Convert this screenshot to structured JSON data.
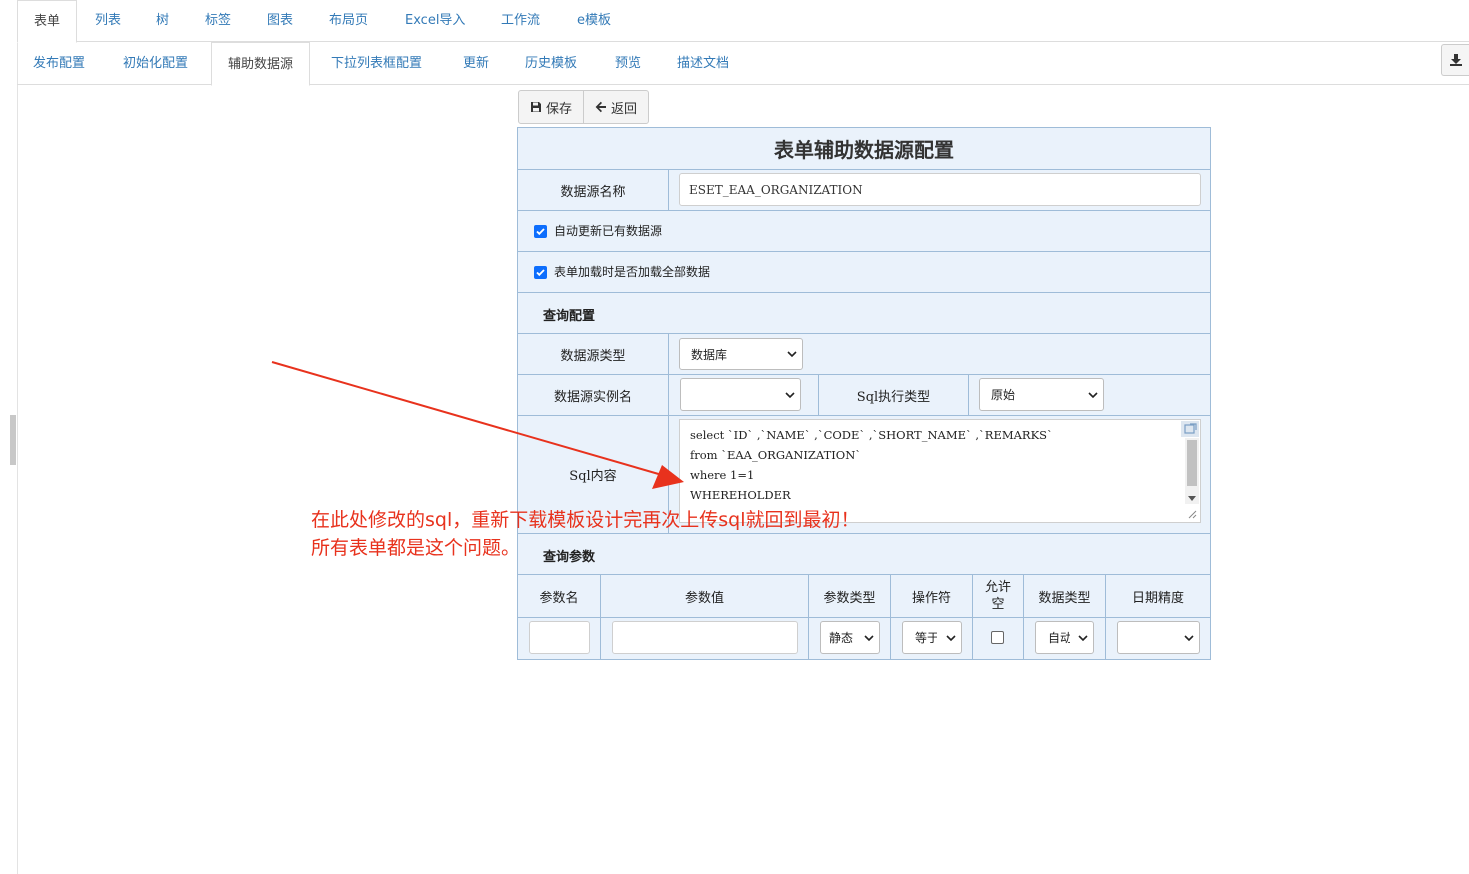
{
  "top_tabs": [
    "表单",
    "列表",
    "树",
    "标签",
    "图表",
    "布局页",
    "Excel导入",
    "工作流",
    "e模板"
  ],
  "sub_tabs": [
    "发布配置",
    "初始化配置",
    "辅助数据源",
    "下拉列表框配置",
    "更新",
    "历史模板",
    "预览",
    "描述文档"
  ],
  "toolbar": {
    "save_label": "保存",
    "back_label": "返回"
  },
  "form": {
    "title": "表单辅助数据源配置",
    "ds_name_label": "数据源名称",
    "ds_name_value": "ESET_EAA_ORGANIZATION",
    "auto_update_label": "自动更新已有数据源",
    "auto_update_checked": true,
    "load_all_label": "表单加载时是否加载全部数据",
    "load_all_checked": true,
    "query_config_label": "查询配置",
    "ds_type_label": "数据源类型",
    "ds_type_value": "数据库",
    "ds_instance_label": "数据源实例名",
    "ds_instance_value": "",
    "sql_exec_type_label": "Sql执行类型",
    "sql_exec_type_value": "原始",
    "sql_content_label": "Sql内容",
    "sql_lines": [
      "select `ID` ,`NAME` ,`CODE` ,`SHORT_NAME` ,`REMARKS`",
      "from `EAA_ORGANIZATION`",
      "where 1=1",
      "WHEREHOLDER"
    ],
    "query_params_label": "查询参数",
    "param_headers": [
      "参数名",
      "参数值",
      "参数类型",
      "操作符",
      "允许空",
      "数据类型",
      "日期精度"
    ],
    "param_row": {
      "param_type": "静态",
      "operator": "等于",
      "nullable_checked": false,
      "data_type": "自动",
      "date_precision": ""
    }
  },
  "annotation": {
    "line1": "在此处修改的sql，重新下载模板设计完再次上传sql就回到最初！",
    "line2": "所有表单都是这个问题。",
    "color": "#e8321d"
  },
  "colors": {
    "link": "#337ab7",
    "form_bg": "#eaf2fb",
    "form_border": "#9fbcd8",
    "checkbox": "#0d6efd"
  }
}
